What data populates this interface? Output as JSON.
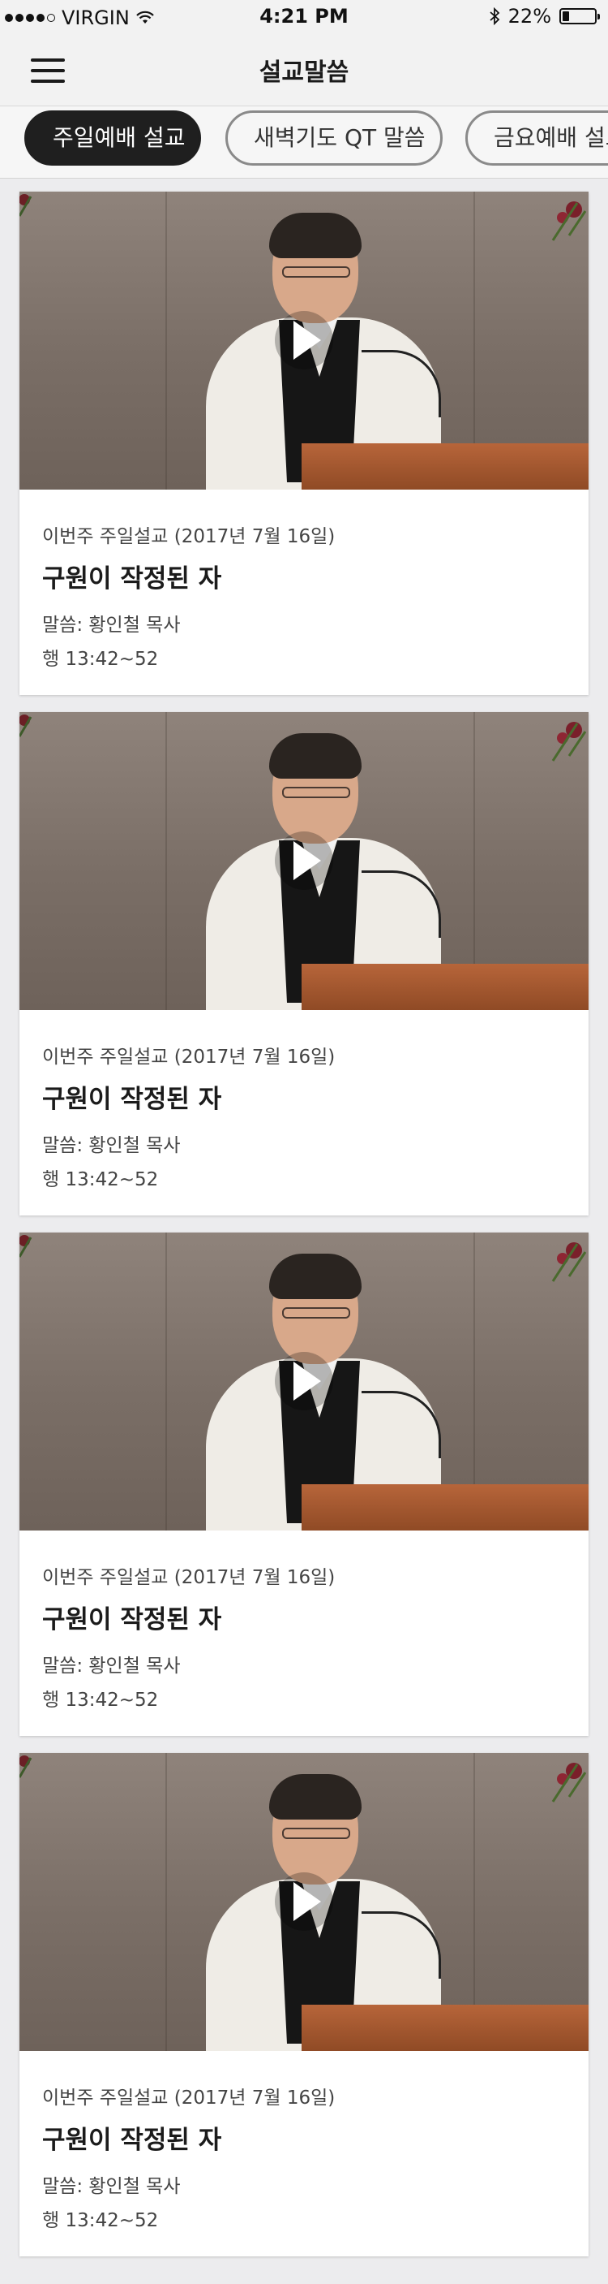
{
  "status_bar": {
    "carrier": "VIRGIN",
    "time": "4:21 PM",
    "battery_percent": "22%",
    "battery_level": 0.22,
    "signal_dots_filled": 4,
    "signal_dots_total": 5
  },
  "navbar": {
    "title": "설교말씀",
    "menu_icon": "hamburger-icon"
  },
  "tabs": [
    {
      "label": "주일예배 설교",
      "active": true
    },
    {
      "label": "새벽기도 QT 말씀",
      "active": false
    },
    {
      "label": "금요예배 설교",
      "active": false
    }
  ],
  "cards": [
    {
      "subtitle": "이번주 주일설교 (2017년 7월 16일)",
      "title": "구원이 작정된 자",
      "preacher": "말씀: 황인철 목사",
      "scripture": "행 13:42~52"
    },
    {
      "subtitle": "이번주 주일설교 (2017년 7월 16일)",
      "title": "구원이 작정된 자",
      "preacher": "말씀: 황인철 목사",
      "scripture": "행 13:42~52"
    },
    {
      "subtitle": "이번주 주일설교 (2017년 7월 16일)",
      "title": "구원이 작정된 자",
      "preacher": "말씀: 황인철 목사",
      "scripture": "행 13:42~52"
    },
    {
      "subtitle": "이번주 주일설교 (2017년 7월 16일)",
      "title": "구원이 작정된 자",
      "preacher": "말씀: 황인철 목사",
      "scripture": "행 13:42~52"
    }
  ],
  "colors": {
    "active_tab_bg": "#1f1f1f",
    "inactive_tab_border": "#8a8a8a",
    "page_bg": "#ececee"
  }
}
